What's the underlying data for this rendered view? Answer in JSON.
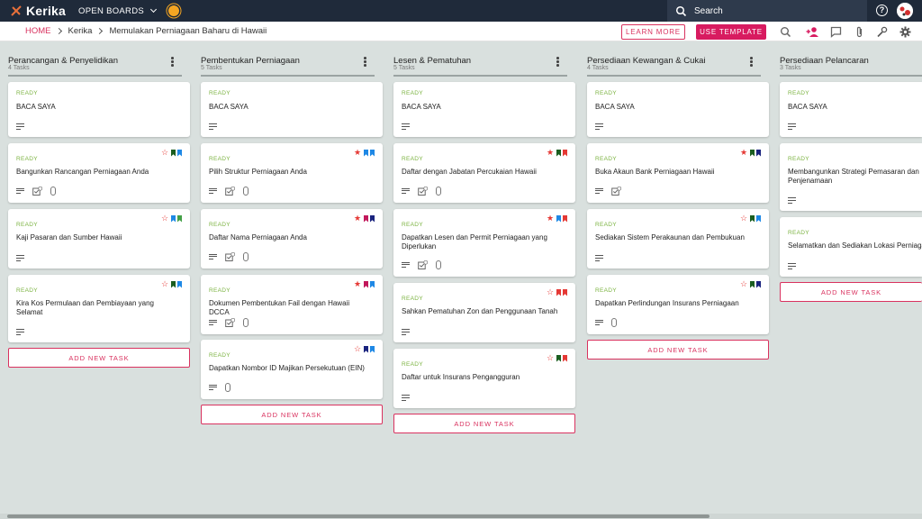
{
  "app": {
    "name": "Kerika"
  },
  "topbar": {
    "open_boards_label": "OPEN BOARDS",
    "search_label": "Search",
    "help_label": "?"
  },
  "breadcrumb": {
    "home": "HOME",
    "item1": "Kerika",
    "item2": "Memulakan Perniagaan Baharu di Hawaii"
  },
  "actions": {
    "learn_more": "LEARN MORE",
    "use_template": "USE TEMPLATE"
  },
  "columns": [
    {
      "title": "Perancangan & Penyelidikan",
      "count": "4 Tasks",
      "add_label": "ADD NEW TASK",
      "cards": [
        {
          "status": "READY",
          "title": "BACA SAYA"
        },
        {
          "status": "READY",
          "title": "Bangunkan Rancangan Perniagaan Anda"
        },
        {
          "status": "READY",
          "title": "Kaji Pasaran dan Sumber Hawaii"
        },
        {
          "status": "READY",
          "title": "Kira Kos Permulaan dan Pembiayaan yang Selamat"
        }
      ]
    },
    {
      "title": "Pembentukan Perniagaan",
      "count": "5 Tasks",
      "add_label": "ADD NEW TASK",
      "cards": [
        {
          "status": "READY",
          "title": "BACA SAYA"
        },
        {
          "status": "READY",
          "title": "Pilih Struktur Perniagaan Anda"
        },
        {
          "status": "READY",
          "title": "Daftar Nama Perniagaan Anda"
        },
        {
          "status": "READY",
          "title": "Dokumen Pembentukan Fail dengan Hawaii DCCA"
        },
        {
          "status": "READY",
          "title": "Dapatkan Nombor ID Majikan Persekutuan (EIN)"
        }
      ]
    },
    {
      "title": "Lesen & Pematuhan",
      "count": "5 Tasks",
      "add_label": "ADD NEW TASK",
      "cards": [
        {
          "status": "READY",
          "title": "BACA SAYA"
        },
        {
          "status": "READY",
          "title": "Daftar dengan Jabatan Percukaian Hawaii"
        },
        {
          "status": "READY",
          "title": "Dapatkan Lesen dan Permit Perniagaan yang Diperlukan"
        },
        {
          "status": "READY",
          "title": "Sahkan Pematuhan Zon dan Penggunaan Tanah"
        },
        {
          "status": "READY",
          "title": "Daftar untuk Insurans Pengangguran"
        }
      ]
    },
    {
      "title": "Persediaan Kewangan & Cukai",
      "count": "4 Tasks",
      "add_label": "ADD NEW TASK",
      "cards": [
        {
          "status": "READY",
          "title": "BACA SAYA"
        },
        {
          "status": "READY",
          "title": "Buka Akaun Bank Perniagaan Hawaii"
        },
        {
          "status": "READY",
          "title": "Sediakan Sistem Perakaunan dan Pembukuan"
        },
        {
          "status": "READY",
          "title": "Dapatkan Perlindungan Insurans Perniagaan"
        }
      ]
    },
    {
      "title": "Persediaan Pelancaran",
      "count": "3 Tasks",
      "add_label": "ADD NEW TASK",
      "cards": [
        {
          "status": "READY",
          "title": "BACA SAYA"
        },
        {
          "status": "READY",
          "title": "Membangunkan Strategi Pemasaran dan Penjenamaan"
        },
        {
          "status": "READY",
          "title": "Selamatkan dan Sediakan Lokasi Perniagaan"
        }
      ]
    }
  ],
  "colors": {
    "accent": "#d9325f",
    "ready": "#7cb342",
    "topbar": "#1f2a3a",
    "board_bg": "#d9e0de"
  }
}
